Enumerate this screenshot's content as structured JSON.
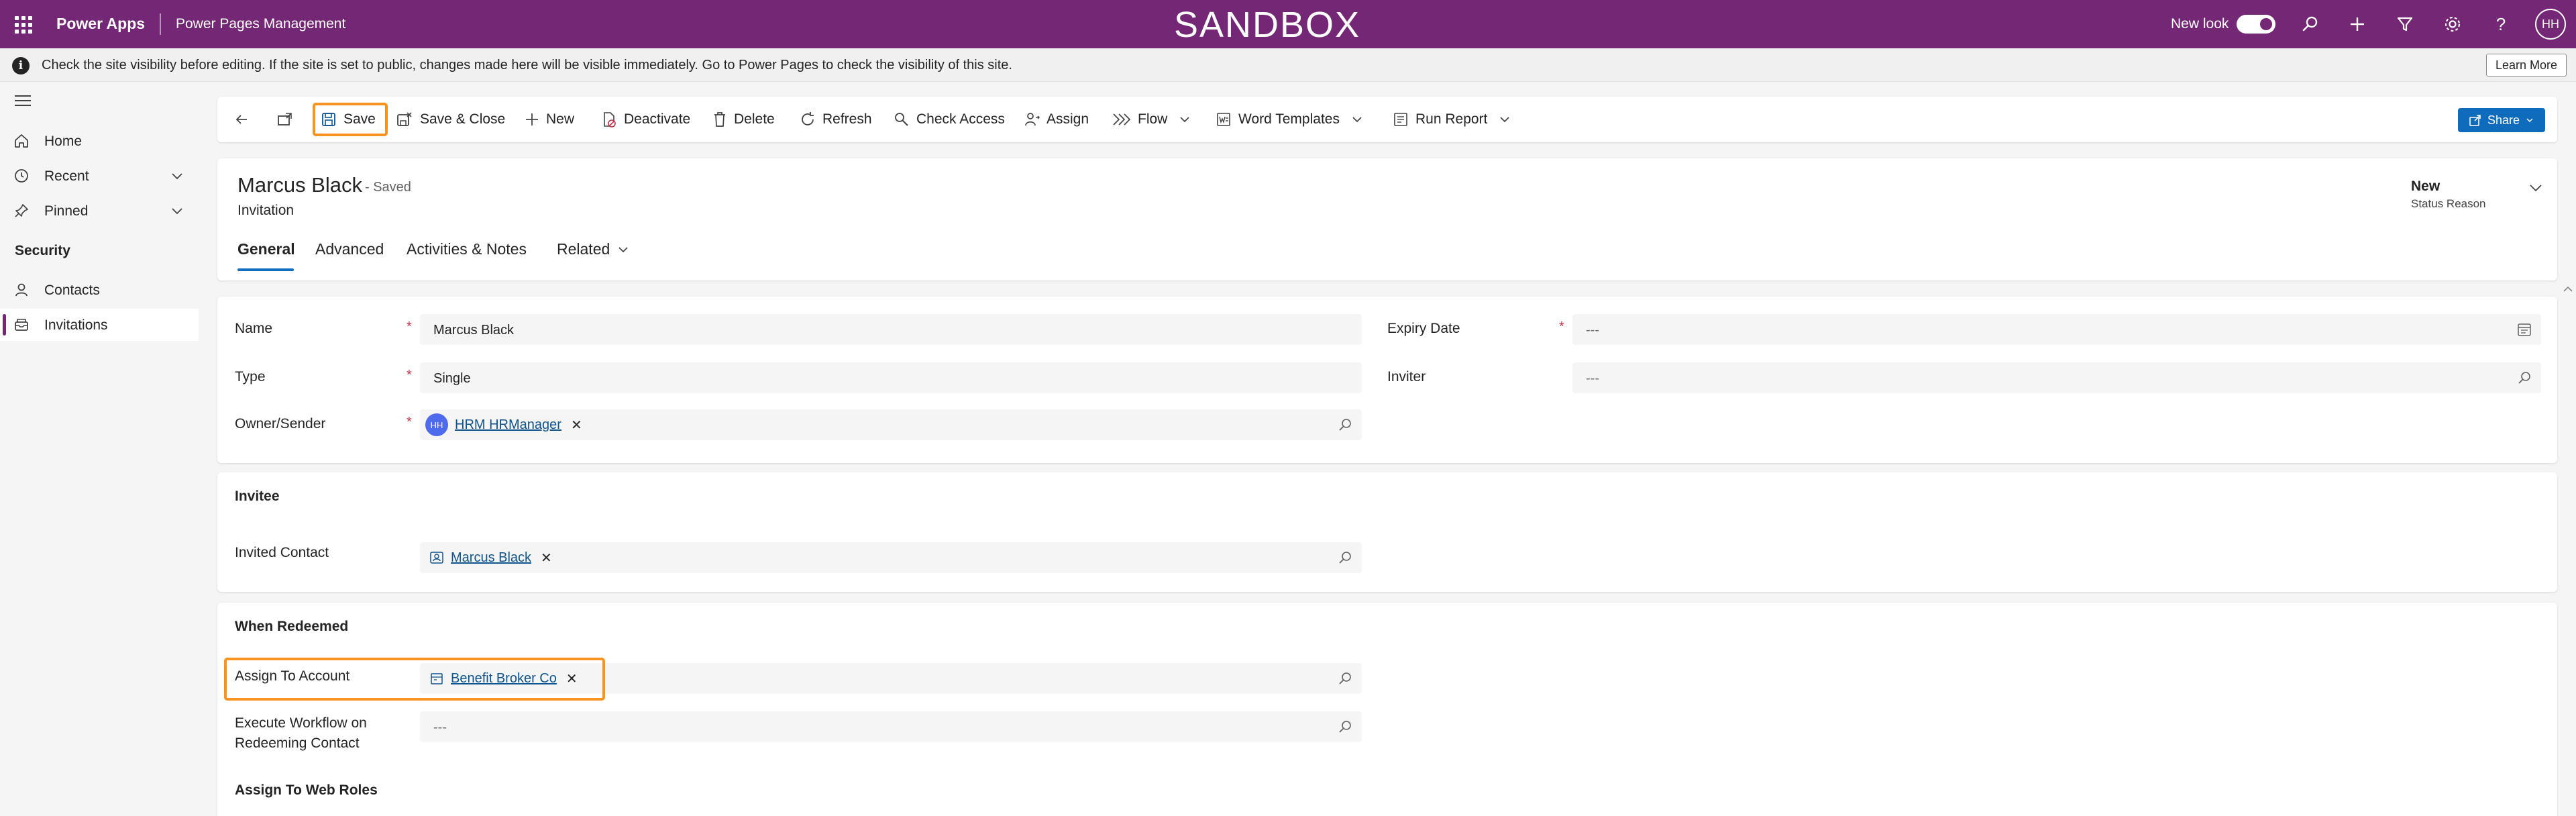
{
  "topbar": {
    "app_name": "Power Apps",
    "module_name": "Power Pages Management",
    "environment_label": "SANDBOX",
    "new_look_label": "New look",
    "new_look_enabled": true,
    "user_initials": "HH",
    "bar_color": "#742774"
  },
  "banner": {
    "text": "Check the site visibility before editing. If the site is set to public, changes made here will be visible immediately. Go to Power Pages to check the visibility of this site.",
    "learn_more": "Learn More"
  },
  "nav": {
    "items": [
      {
        "label": "Home",
        "icon": "home-icon"
      },
      {
        "label": "Recent",
        "icon": "clock-icon",
        "expandable": true
      },
      {
        "label": "Pinned",
        "icon": "pin-icon",
        "expandable": true
      }
    ],
    "section_title": "Security",
    "section_items": [
      {
        "label": "Contacts",
        "icon": "person-icon"
      },
      {
        "label": "Invitations",
        "icon": "mail-inbox-icon",
        "selected": true
      }
    ]
  },
  "commands": {
    "save": "Save",
    "save_close": "Save & Close",
    "new": "New",
    "deactivate": "Deactivate",
    "delete": "Delete",
    "refresh": "Refresh",
    "check_access": "Check Access",
    "assign": "Assign",
    "flow": "Flow",
    "word_templates": "Word Templates",
    "run_report": "Run Report",
    "share": "Share"
  },
  "record": {
    "title": "Marcus Black",
    "saved_state": "- Saved",
    "entity": "Invitation",
    "status_value": "New",
    "status_label": "Status Reason"
  },
  "tabs": [
    "General",
    "Advanced",
    "Activities & Notes",
    "Related"
  ],
  "general": {
    "name_label": "Name",
    "name_value": "Marcus Black",
    "type_label": "Type",
    "type_value": "Single",
    "owner_label": "Owner/Sender",
    "owner_initials": "HH",
    "owner_value": "HRM HRManager",
    "expiry_label": "Expiry Date",
    "expiry_value": "---",
    "inviter_label": "Inviter",
    "inviter_value": "---"
  },
  "invitee": {
    "section_title": "Invitee",
    "contact_label": "Invited Contact",
    "contact_value": "Marcus Black"
  },
  "redeemed": {
    "section_title": "When Redeemed",
    "account_label": "Assign To Account",
    "account_value": "Benefit Broker Co",
    "workflow_label_1": "Execute Workflow on",
    "workflow_label_2": "Redeeming Contact",
    "workflow_value": "---",
    "web_roles_title": "Assign To Web Roles"
  },
  "highlight_color": "#f7931e",
  "accent_color": "#0f6cbd"
}
